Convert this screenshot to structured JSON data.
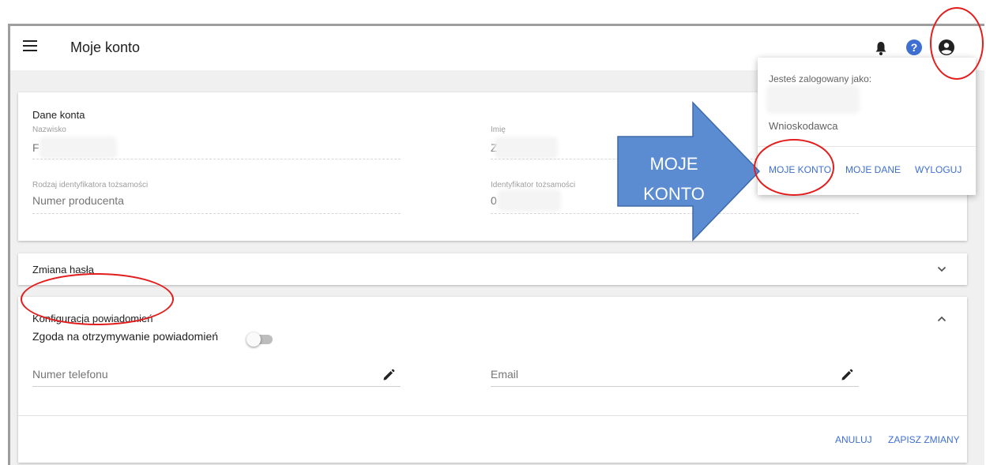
{
  "header": {
    "title": "Moje konto",
    "icons": [
      "menu-icon",
      "bell-icon",
      "help-icon",
      "account-circle-icon"
    ],
    "help_glyph": "?"
  },
  "account_data": {
    "section_title": "Dane konta",
    "surname_label": "Nazwisko",
    "surname_value": "F",
    "first_name_label": "Imię",
    "first_name_value": "Z",
    "id_type_label": "Rodzaj identyfikatora tożsamości",
    "id_type_value": "Numer producenta",
    "id_label": "Identyfikator tożsamości",
    "id_value": "0"
  },
  "password_section": {
    "title": "Zmiana hasła"
  },
  "notifications": {
    "title": "Konfiguracja powiadomień",
    "consent_label": "Zgoda na otrzymywanie powiadomień",
    "consent_enabled": false,
    "phone_label": "Numer telefonu",
    "email_label": "Email",
    "cancel_label": "ANULUJ",
    "save_label": "ZAPISZ ZMIANY"
  },
  "user_menu": {
    "logged_in_as": "Jesteś zalogowany jako:",
    "role": "Wnioskodawca",
    "my_account_label": "MOJE KONTO",
    "my_data_label": "MOJE DANE",
    "logout_label": "WYLOGUJ"
  },
  "callout": {
    "line1": "MOJE",
    "line2": "KONTO"
  },
  "colors": {
    "accent": "#3f6fd1",
    "callout_fill": "#5b8bd0",
    "annotation": "#e31d1d"
  }
}
